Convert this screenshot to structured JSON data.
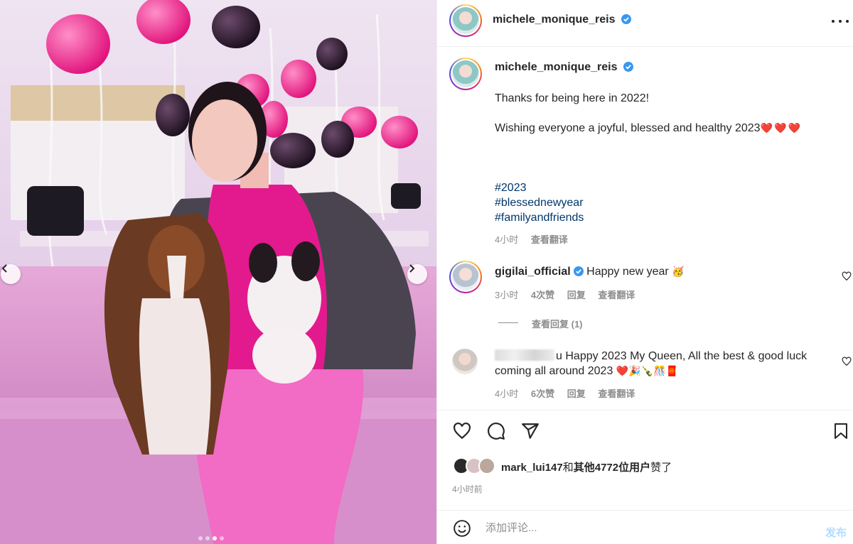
{
  "header": {
    "username": "michele_monique_reis",
    "more_icon": "more-horizontal-icon"
  },
  "caption": {
    "username": "michele_monique_reis",
    "line1": "Thanks for being here in 2022!",
    "line2": "Wishing everyone a joyful, blessed and healthy 2023",
    "line2_emojis": "❤️❤️❤️",
    "hashtags": [
      "#2023",
      "#blessednewyear",
      "#familyandfriends"
    ],
    "time": "4小时",
    "translate": "查看翻译"
  },
  "comments": [
    {
      "username": "gigilai_official",
      "verified": true,
      "text": "Happy new year",
      "emoji": "🥳",
      "time": "3小时",
      "likes": "4次赞",
      "reply": "回复",
      "translate": "查看翻译",
      "view_replies": "查看回复 (1)"
    },
    {
      "username_suffix": "u",
      "text": "Happy 2023 My Queen, All the best & good luck",
      "text2": "coming all around 2023",
      "emojis": "❤️🎉🍾🎊🧧",
      "time": "4小时",
      "likes": "6次赞",
      "reply": "回复",
      "translate": "查看翻译"
    }
  ],
  "likes": {
    "user": "mark_lui147",
    "connector": "和",
    "others": "其他4772位用户",
    "suffix": "赞了"
  },
  "post_time": "4小时前",
  "comment_box": {
    "placeholder": "添加评论...",
    "post_label": "发布"
  },
  "carousel": {
    "slide_count": 4,
    "active_index": 2
  },
  "colors": {
    "link": "#00376b",
    "muted": "#8e8e8e",
    "verified": "#3897f0",
    "post_disabled": "#b3dbff"
  }
}
